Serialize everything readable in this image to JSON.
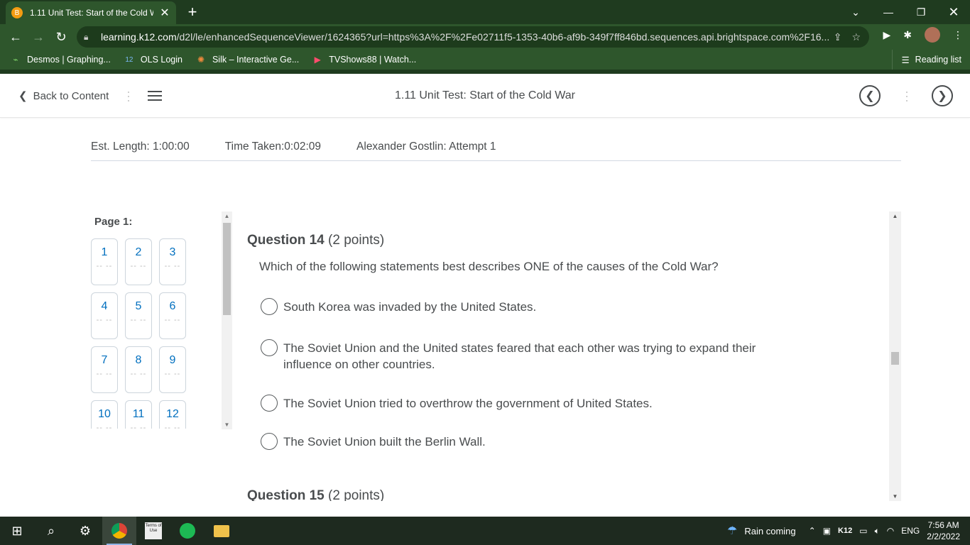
{
  "browser": {
    "tab_title": "1.11 Unit Test: Start of the Cold W",
    "tab_favicon_letter": "B",
    "url_host": "learning.k12.com",
    "url_rest": "/d2l/le/enhancedSequenceViewer/1624365?url=https%3A%2F%2Fe02711f5-1353-40b6-af9b-349f7ff846bd.sequences.api.brightspace.com%2F16...",
    "bookmarks": [
      {
        "label": "Desmos | Graphing...",
        "icon": "desmos-icon"
      },
      {
        "label": "OLS Login",
        "icon": "k12-icon"
      },
      {
        "label": "Silk – Interactive Ge...",
        "icon": "silk-icon"
      },
      {
        "label": "TVShows88 | Watch...",
        "icon": "play-icon"
      }
    ],
    "reading_list": "Reading list"
  },
  "header": {
    "back_label": "Back to Content",
    "title": "1.11 Unit Test: Start of the Cold War"
  },
  "info": {
    "est_length": "Est. Length: 1:00:00",
    "time_taken": "Time Taken:0:02:09",
    "attempt": "Alexander Gostlin: Attempt 1"
  },
  "nav": {
    "page_label": "Page 1:",
    "questions": [
      "1",
      "2",
      "3",
      "4",
      "5",
      "6",
      "7",
      "8",
      "9",
      "10",
      "11",
      "12"
    ],
    "dash": "-- --"
  },
  "question": {
    "title": "Question 14",
    "points": "(2 points)",
    "text": "Which of the following statements best describes ONE of the causes of the Cold War?",
    "options": [
      "South Korea was invaded by the United States.",
      "The Soviet Union and the United states feared that each other was trying to expand their influence on other countries.",
      "The Soviet Union tried to overthrow the government of United States.",
      "The Soviet Union built the Berlin Wall."
    ]
  },
  "next_question": {
    "title": "Question 15",
    "points": "(2 points)"
  },
  "taskbar": {
    "weather": "Rain coming",
    "time": "7:56 AM",
    "date": "2/2/2022",
    "lang": "ENG",
    "k12": "K12",
    "terms": "Terms of Use"
  }
}
